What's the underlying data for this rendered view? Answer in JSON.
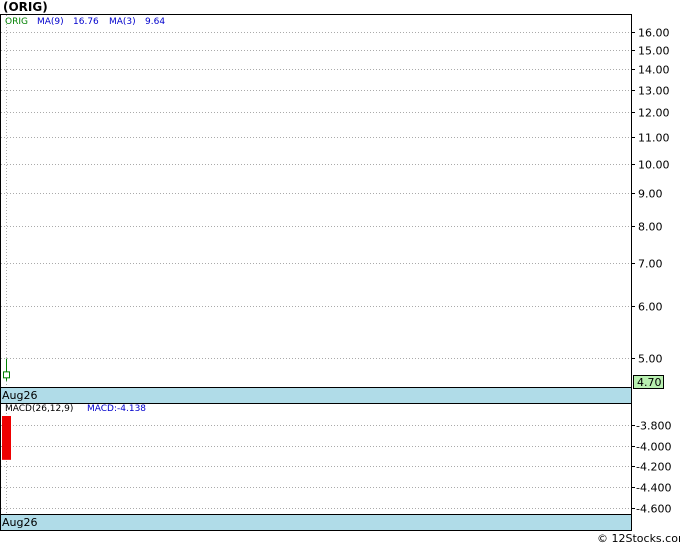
{
  "title": "(ORIG)",
  "footer": "© 12Stocks.com",
  "colors": {
    "ticker": "#008000",
    "ma": "#0000cc",
    "date_band": "#b0dce8",
    "price_box": "#b8f0b0",
    "macd_bar": "#ee0000",
    "grid": "#aaaaaa"
  },
  "price_panel": {
    "legend": {
      "ticker": "ORIG",
      "ma9_label": "MA(9)",
      "ma9_value": "16.76",
      "ma3_label": "MA(3)",
      "ma3_value": "9.64"
    },
    "date_label": "Aug26",
    "last_price": "4.70"
  },
  "macd_panel": {
    "legend": {
      "label": "MACD(26,12,9)",
      "value_label": "MACD:-4.138"
    },
    "date_label": "Aug26"
  },
  "chart_data": [
    {
      "type": "candlestick",
      "scale": "log",
      "ylim": [
        4.5,
        17.0
      ],
      "y_ticks": [
        "16.00",
        "15.00",
        "14.00",
        "13.00",
        "12.00",
        "11.00",
        "10.00",
        "9.00",
        "8.00",
        "7.00",
        "6.00",
        "5.00"
      ],
      "x": [
        "Aug26"
      ],
      "candles": [
        {
          "x": "Aug26",
          "open": 4.75,
          "high": 4.98,
          "low": 4.6,
          "close": 4.65
        }
      ],
      "last_value": 4.7,
      "ma9": 16.76,
      "ma3": 9.64
    },
    {
      "type": "bar",
      "ylim": [
        -4.66,
        -3.6
      ],
      "y_ticks": [
        "-3.800",
        "-4.000",
        "-4.200",
        "-4.400",
        "-4.600"
      ],
      "x": [
        "Aug26"
      ],
      "values": [
        -4.138
      ]
    }
  ]
}
